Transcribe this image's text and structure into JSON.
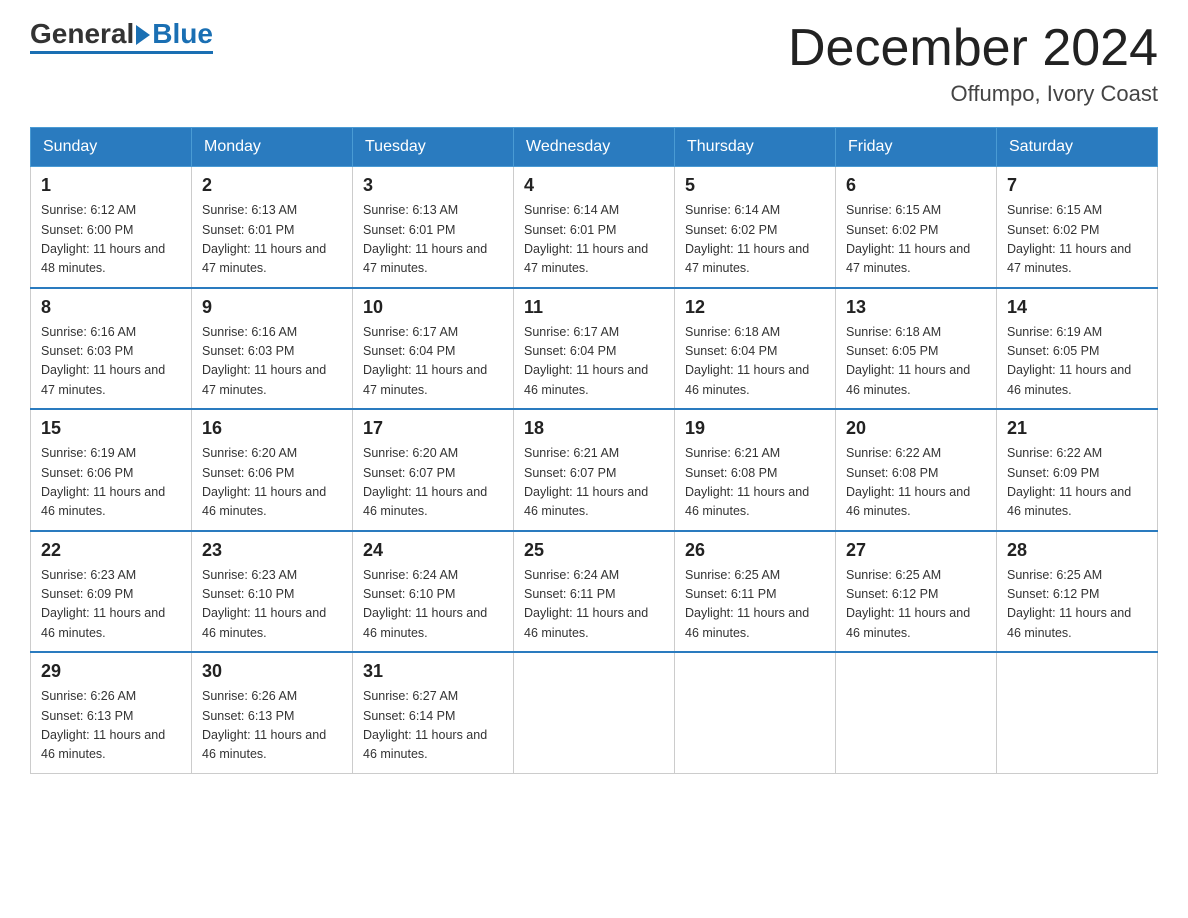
{
  "header": {
    "logo": {
      "general": "General",
      "blue": "Blue"
    },
    "title": "December 2024",
    "location": "Offumpo, Ivory Coast"
  },
  "days_of_week": [
    "Sunday",
    "Monday",
    "Tuesday",
    "Wednesday",
    "Thursday",
    "Friday",
    "Saturday"
  ],
  "weeks": [
    [
      {
        "day": "1",
        "sunrise": "6:12 AM",
        "sunset": "6:00 PM",
        "daylight": "11 hours and 48 minutes."
      },
      {
        "day": "2",
        "sunrise": "6:13 AM",
        "sunset": "6:01 PM",
        "daylight": "11 hours and 47 minutes."
      },
      {
        "day": "3",
        "sunrise": "6:13 AM",
        "sunset": "6:01 PM",
        "daylight": "11 hours and 47 minutes."
      },
      {
        "day": "4",
        "sunrise": "6:14 AM",
        "sunset": "6:01 PM",
        "daylight": "11 hours and 47 minutes."
      },
      {
        "day": "5",
        "sunrise": "6:14 AM",
        "sunset": "6:02 PM",
        "daylight": "11 hours and 47 minutes."
      },
      {
        "day": "6",
        "sunrise": "6:15 AM",
        "sunset": "6:02 PM",
        "daylight": "11 hours and 47 minutes."
      },
      {
        "day": "7",
        "sunrise": "6:15 AM",
        "sunset": "6:02 PM",
        "daylight": "11 hours and 47 minutes."
      }
    ],
    [
      {
        "day": "8",
        "sunrise": "6:16 AM",
        "sunset": "6:03 PM",
        "daylight": "11 hours and 47 minutes."
      },
      {
        "day": "9",
        "sunrise": "6:16 AM",
        "sunset": "6:03 PM",
        "daylight": "11 hours and 47 minutes."
      },
      {
        "day": "10",
        "sunrise": "6:17 AM",
        "sunset": "6:04 PM",
        "daylight": "11 hours and 47 minutes."
      },
      {
        "day": "11",
        "sunrise": "6:17 AM",
        "sunset": "6:04 PM",
        "daylight": "11 hours and 46 minutes."
      },
      {
        "day": "12",
        "sunrise": "6:18 AM",
        "sunset": "6:04 PM",
        "daylight": "11 hours and 46 minutes."
      },
      {
        "day": "13",
        "sunrise": "6:18 AM",
        "sunset": "6:05 PM",
        "daylight": "11 hours and 46 minutes."
      },
      {
        "day": "14",
        "sunrise": "6:19 AM",
        "sunset": "6:05 PM",
        "daylight": "11 hours and 46 minutes."
      }
    ],
    [
      {
        "day": "15",
        "sunrise": "6:19 AM",
        "sunset": "6:06 PM",
        "daylight": "11 hours and 46 minutes."
      },
      {
        "day": "16",
        "sunrise": "6:20 AM",
        "sunset": "6:06 PM",
        "daylight": "11 hours and 46 minutes."
      },
      {
        "day": "17",
        "sunrise": "6:20 AM",
        "sunset": "6:07 PM",
        "daylight": "11 hours and 46 minutes."
      },
      {
        "day": "18",
        "sunrise": "6:21 AM",
        "sunset": "6:07 PM",
        "daylight": "11 hours and 46 minutes."
      },
      {
        "day": "19",
        "sunrise": "6:21 AM",
        "sunset": "6:08 PM",
        "daylight": "11 hours and 46 minutes."
      },
      {
        "day": "20",
        "sunrise": "6:22 AM",
        "sunset": "6:08 PM",
        "daylight": "11 hours and 46 minutes."
      },
      {
        "day": "21",
        "sunrise": "6:22 AM",
        "sunset": "6:09 PM",
        "daylight": "11 hours and 46 minutes."
      }
    ],
    [
      {
        "day": "22",
        "sunrise": "6:23 AM",
        "sunset": "6:09 PM",
        "daylight": "11 hours and 46 minutes."
      },
      {
        "day": "23",
        "sunrise": "6:23 AM",
        "sunset": "6:10 PM",
        "daylight": "11 hours and 46 minutes."
      },
      {
        "day": "24",
        "sunrise": "6:24 AM",
        "sunset": "6:10 PM",
        "daylight": "11 hours and 46 minutes."
      },
      {
        "day": "25",
        "sunrise": "6:24 AM",
        "sunset": "6:11 PM",
        "daylight": "11 hours and 46 minutes."
      },
      {
        "day": "26",
        "sunrise": "6:25 AM",
        "sunset": "6:11 PM",
        "daylight": "11 hours and 46 minutes."
      },
      {
        "day": "27",
        "sunrise": "6:25 AM",
        "sunset": "6:12 PM",
        "daylight": "11 hours and 46 minutes."
      },
      {
        "day": "28",
        "sunrise": "6:25 AM",
        "sunset": "6:12 PM",
        "daylight": "11 hours and 46 minutes."
      }
    ],
    [
      {
        "day": "29",
        "sunrise": "6:26 AM",
        "sunset": "6:13 PM",
        "daylight": "11 hours and 46 minutes."
      },
      {
        "day": "30",
        "sunrise": "6:26 AM",
        "sunset": "6:13 PM",
        "daylight": "11 hours and 46 minutes."
      },
      {
        "day": "31",
        "sunrise": "6:27 AM",
        "sunset": "6:14 PM",
        "daylight": "11 hours and 46 minutes."
      },
      null,
      null,
      null,
      null
    ]
  ]
}
